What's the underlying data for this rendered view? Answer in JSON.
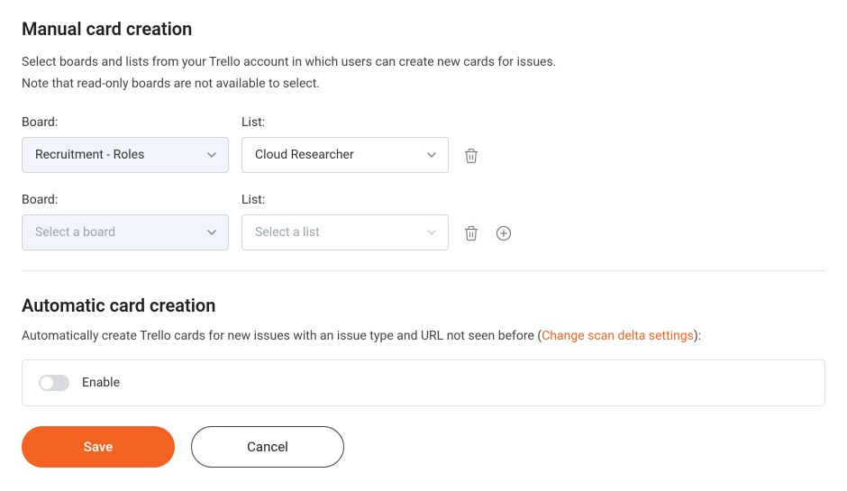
{
  "manual": {
    "heading": "Manual card creation",
    "desc_line1": "Select boards and lists from your Trello account in which users can create new cards for issues.",
    "desc_line2": "Note that read-only boards are not available to select.",
    "board_label": "Board:",
    "list_label": "List:",
    "rows": [
      {
        "board_value": "Recruitment - Roles",
        "list_value": "Cloud Researcher"
      },
      {
        "board_placeholder": "Select a board",
        "list_placeholder": "Select a list"
      }
    ]
  },
  "auto": {
    "heading": "Automatic card creation",
    "desc_prefix": "Automatically create Trello cards for new issues with an issue type and URL not seen before  (",
    "link_text": "Change scan delta settings",
    "desc_suffix": "):",
    "toggle_label": "Enable",
    "toggle_on": false
  },
  "buttons": {
    "save": "Save",
    "cancel": "Cancel"
  }
}
